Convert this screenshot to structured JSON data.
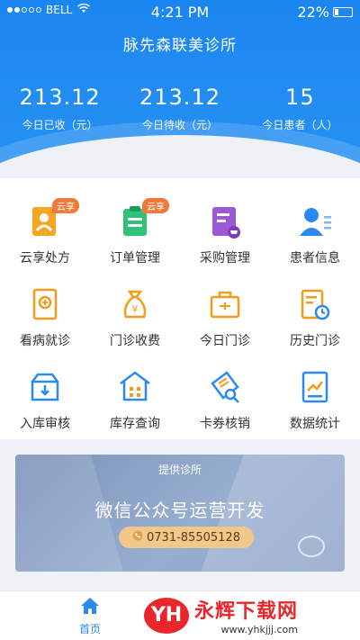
{
  "status": {
    "carrier": "BELL",
    "time": "4:21 PM",
    "battery": "22%",
    "battery_level": 0.22,
    "wifi": "wifi-icon"
  },
  "header": {
    "title": "脉先森联美诊所"
  },
  "stats": [
    {
      "value": "213.12",
      "label": "今日已收（元）"
    },
    {
      "value": "213.12",
      "label": "今日待收（元）"
    },
    {
      "value": "15",
      "label": "今日患者（人）"
    }
  ],
  "grid": [
    {
      "label": "云享处方",
      "icon": "cloud-prescription-icon",
      "badge": "云享",
      "color": "#f5a623"
    },
    {
      "label": "订单管理",
      "icon": "order-icon",
      "badge": "云享",
      "color": "#2fc37a"
    },
    {
      "label": "采购管理",
      "icon": "purchase-icon",
      "badge": "",
      "color": "#9b59d6"
    },
    {
      "label": "患者信息",
      "icon": "patient-icon",
      "badge": "",
      "color": "#2b8af1"
    },
    {
      "label": "看病就诊",
      "icon": "consult-icon",
      "badge": "",
      "color": "#f39b1a"
    },
    {
      "label": "门诊收费",
      "icon": "money-bag-icon",
      "badge": "",
      "color": "#f39b1a"
    },
    {
      "label": "今日门诊",
      "icon": "today-clinic-icon",
      "badge": "",
      "color": "#f39b1a"
    },
    {
      "label": "历史门诊",
      "icon": "history-icon",
      "badge": "",
      "color": "#f39b1a"
    },
    {
      "label": "入库审核",
      "icon": "inbox-icon",
      "badge": "",
      "color": "#2b8af1"
    },
    {
      "label": "库存查询",
      "icon": "warehouse-icon",
      "badge": "",
      "color": "#2b8af1"
    },
    {
      "label": "卡券核销",
      "icon": "coupon-icon",
      "badge": "",
      "color": "#2b8af1"
    },
    {
      "label": "数据统计",
      "icon": "chart-icon",
      "badge": "",
      "color": "#2b8af1"
    }
  ],
  "banner": {
    "top": "提供诊所",
    "headline": "微信公众号运营开发",
    "phone": "0731-85505128"
  },
  "tabbar": {
    "home": "首页"
  },
  "watermark": {
    "logo": "YH",
    "name": "永辉下载网",
    "url": "www.yhkjjj.com"
  }
}
